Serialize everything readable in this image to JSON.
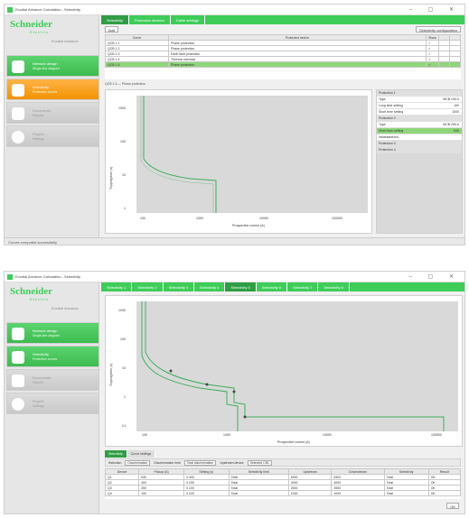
{
  "colors": {
    "accent": "#3dcd58",
    "accent_dark": "#2e9e44",
    "orange": "#f39200",
    "curve": "#3dae5b",
    "selected_row": "#8fd67a"
  },
  "window1": {
    "title": "Ecodial Advance Calculation - Selectivity",
    "logo": {
      "brand": "Schneider",
      "sub": "Electric",
      "product": "Ecodial Advance"
    },
    "nav": [
      {
        "label": "Network design",
        "sub": "Single-line diagram",
        "icon": "diagram-icon"
      },
      {
        "label": "Selectivity",
        "sub": "Protection curves",
        "icon": "curve-icon"
      },
      {
        "label": "Documents",
        "sub": "Reports",
        "icon": "document-icon"
      },
      {
        "label": "Project",
        "sub": "Settings",
        "icon": "settings-icon"
      }
    ],
    "tabs": [
      "Selectivity",
      "Protection devices",
      "Cable settings"
    ],
    "toolbar": {
      "add": "Add",
      "configure": "Selectivity configuration"
    },
    "table": {
      "headers": [
        "Curve",
        "Protected device",
        "Show",
        "",
        ""
      ],
      "rows": [
        [
          "QCB 1.1",
          "Phase protection",
          "✓"
        ],
        [
          "QCB 1.2",
          "Phase protection",
          "✓"
        ],
        [
          "QCB 1.3",
          "Earth fault protection",
          "✓"
        ],
        [
          "QCB 1.4",
          "Thermal overload",
          "✓"
        ],
        [
          "QCB 1.5",
          "Phase protection",
          "✓"
        ]
      ],
      "selected_index": 4
    },
    "curve_label": "QCB 1.5 — Phase protection",
    "chart": {
      "ylabel": "Tripping time (s)",
      "xlabel": "Prospective current (A)",
      "yticks": [
        "1000",
        "100",
        "10",
        "1"
      ],
      "xticks": [
        "100",
        "1000",
        "10000",
        "100000"
      ]
    },
    "panel": [
      {
        "label": "Protection 1",
        "value": "",
        "kind": "hdr"
      },
      {
        "label": "Type",
        "value": "MCB  100 A",
        "kind": ""
      },
      {
        "label": "Long time setting",
        "value": "100",
        "kind": ""
      },
      {
        "label": "Short time setting",
        "value": "1000",
        "kind": ""
      },
      {
        "label": "Protection 2",
        "value": "",
        "kind": "hdr"
      },
      {
        "label": "Type",
        "value": "MCB  250 A",
        "kind": ""
      },
      {
        "label": "Short time setting",
        "value": "630",
        "kind": "hi"
      },
      {
        "label": "Instantaneous",
        "value": "",
        "kind": ""
      },
      {
        "label": "Protection 3",
        "value": "",
        "kind": "hdr"
      },
      {
        "label": "Protection 4",
        "value": "",
        "kind": "hdr"
      }
    ],
    "status": "Curves computed successfully"
  },
  "window2": {
    "title": "Ecodial Advance Calculation - Selectivity",
    "tabs": [
      "Selectivity 1",
      "Selectivity 2",
      "Selectivity 3",
      "Selectivity 4",
      "Selectivity 5",
      "Selectivity 6",
      "Selectivity 7",
      "Selectivity 8"
    ],
    "active_tab": 4,
    "chart": {
      "ylabel": "Tripping time (s)",
      "xlabel": "Prospective current (A)",
      "yticks": [
        "1000",
        "100",
        "10",
        "1",
        "0.1"
      ],
      "xticks": [
        "100",
        "1000",
        "10000",
        "100000"
      ]
    },
    "subtabs": [
      "Selectivity",
      "Curve settings"
    ],
    "filters": [
      {
        "label": "Selection",
        "value": "Discrimination"
      },
      {
        "label": "Discrimination limit",
        "value": "Total discrimination"
      },
      {
        "label": "Upstream device",
        "value": "Selected CB1"
      }
    ],
    "grid": {
      "headers": [
        "Device",
        "Pickup (A)",
        "Setting (s)",
        "Selectivity limit",
        "Upstream",
        "Downstream",
        "Selectivity",
        "Result"
      ],
      "rows": [
        [
          "Q1",
          "630",
          "0.400",
          "Total",
          "6300",
          "6300",
          "Total",
          "OK"
        ],
        [
          "Q2",
          "400",
          "0.200",
          "Total",
          "4000",
          "4000",
          "Total",
          "OK"
        ],
        [
          "Q3",
          "250",
          "0.100",
          "Total",
          "2500",
          "2500",
          "Total",
          "OK"
        ],
        [
          "Q4",
          "100",
          "0.020",
          "Total",
          "1000",
          "1000",
          "Total",
          "OK"
        ]
      ]
    },
    "ok_label": "OK"
  }
}
